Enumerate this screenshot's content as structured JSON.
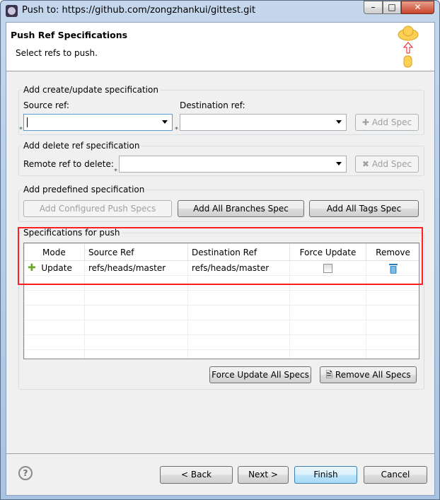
{
  "window": {
    "title": "Push to: https://github.com/zongzhankui/gittest.git"
  },
  "header": {
    "title": "Push Ref Specifications",
    "subtitle": "Select refs to push."
  },
  "create": {
    "legend": "Add create/update specification",
    "source_label": "Source ref:",
    "source_value": "",
    "dest_label": "Destination ref:",
    "dest_value": "",
    "add_label": "Add Spec"
  },
  "delete": {
    "legend": "Add delete ref specification",
    "label": "Remote ref to delete:",
    "value": "",
    "add_label": "Add Spec"
  },
  "predefined": {
    "legend": "Add predefined specification",
    "configured": "Add Configured Push Specs",
    "branches": "Add All Branches Spec",
    "tags": "Add All Tags Spec"
  },
  "specs": {
    "legend": "Specifications for push",
    "columns": [
      "Mode",
      "Source Ref",
      "Destination Ref",
      "Force Update",
      "Remove"
    ],
    "rows": [
      {
        "mode": "Update",
        "source": "refs/heads/master",
        "dest": "refs/heads/master",
        "force": false
      }
    ],
    "force_all": "Force Update All Specs",
    "remove_all": "Remove All Specs"
  },
  "footer": {
    "back": "< Back",
    "next": "Next >",
    "finish": "Finish",
    "cancel": "Cancel"
  },
  "colors": {
    "highlight": "#ff0000",
    "default_button": "#3c7fb1"
  }
}
